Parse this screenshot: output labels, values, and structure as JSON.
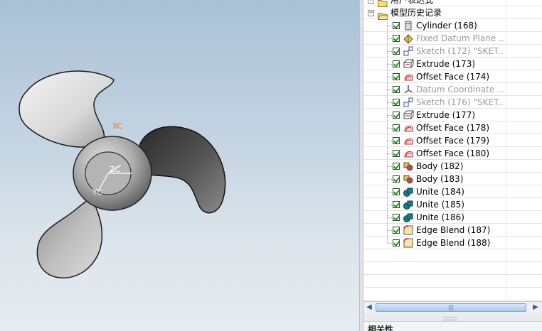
{
  "viewport": {
    "axis_xc": "XC",
    "axis_yc": "YC",
    "axis_zc": "ZC",
    "axis_xc_color": "#d9823b",
    "axis_yc_color": "#ffffff",
    "axis_zc_color": "#ffffff",
    "model": "propeller-3-blade"
  },
  "navigator": {
    "groups": [
      {
        "label": "用户表达式",
        "expanded": false
      },
      {
        "label": "模型历史记录",
        "expanded": true
      }
    ],
    "features": [
      {
        "label": "Cylinder (168)",
        "icon": "cylinder-icon",
        "dim": false
      },
      {
        "label": "Fixed Datum Plane ...",
        "icon": "datum-plane-icon",
        "dim": true
      },
      {
        "label": "Sketch (172) \"SKET...",
        "icon": "sketch-icon",
        "dim": true
      },
      {
        "label": "Extrude (173)",
        "icon": "extrude-icon",
        "dim": false
      },
      {
        "label": "Offset Face (174)",
        "icon": "offset-face-icon",
        "dim": false
      },
      {
        "label": "Datum Coordinate ...",
        "icon": "datum-csys-icon",
        "dim": true
      },
      {
        "label": "Sketch (176) \"SKET...",
        "icon": "sketch-icon",
        "dim": true
      },
      {
        "label": "Extrude (177)",
        "icon": "extrude-icon",
        "dim": false
      },
      {
        "label": "Offset Face (178)",
        "icon": "offset-face-icon",
        "dim": false
      },
      {
        "label": "Offset Face (179)",
        "icon": "offset-face-icon",
        "dim": false
      },
      {
        "label": "Offset Face (180)",
        "icon": "offset-face-icon",
        "dim": false
      },
      {
        "label": "Body (182)",
        "icon": "body-icon",
        "dim": false
      },
      {
        "label": "Body (183)",
        "icon": "body-icon",
        "dim": false
      },
      {
        "label": "Unite (184)",
        "icon": "unite-icon",
        "dim": false
      },
      {
        "label": "Unite (185)",
        "icon": "unite-icon",
        "dim": false
      },
      {
        "label": "Unite (186)",
        "icon": "unite-icon",
        "dim": false
      },
      {
        "label": "Edge Blend (187)",
        "icon": "edge-blend-icon",
        "dim": false
      },
      {
        "label": "Edge Blend (188)",
        "icon": "edge-blend-icon",
        "dim": false
      }
    ],
    "scroll_grip": "|||",
    "bottom_section_title": "相关性"
  },
  "colors": {
    "check": "#1a9a1a",
    "dim_text": "#9a9a9a",
    "tree_line": "#9a9a9a"
  }
}
